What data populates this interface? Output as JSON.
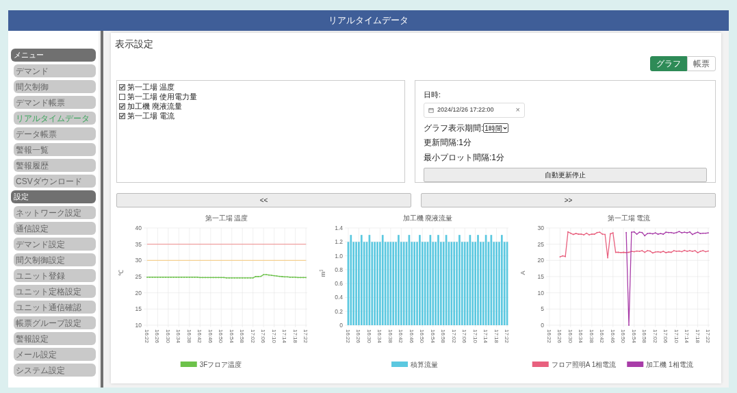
{
  "header": {
    "title": "リアルタイムデータ"
  },
  "sidebar": {
    "sections": [
      {
        "title": "メニュー",
        "items": [
          {
            "label": "デマンド",
            "selected": false
          },
          {
            "label": "間欠制御",
            "selected": false
          },
          {
            "label": "デマンド帳票",
            "selected": false
          },
          {
            "label": "リアルタイムデータ",
            "selected": true
          },
          {
            "label": "データ帳票",
            "selected": false
          },
          {
            "label": "警報一覧",
            "selected": false
          },
          {
            "label": "警報履歴",
            "selected": false
          },
          {
            "label": "CSVダウンロード",
            "selected": false
          }
        ]
      },
      {
        "title": "設定",
        "items": [
          {
            "label": "ネットワーク設定",
            "selected": false
          },
          {
            "label": "通信設定",
            "selected": false
          },
          {
            "label": "デマンド設定",
            "selected": false
          },
          {
            "label": "間欠制御設定",
            "selected": false
          },
          {
            "label": "ユニット登録",
            "selected": false
          },
          {
            "label": "ユニット定格設定",
            "selected": false
          },
          {
            "label": "ユニット通信確認",
            "selected": false
          },
          {
            "label": "帳票グループ設定",
            "selected": false
          },
          {
            "label": "警報設定",
            "selected": false
          },
          {
            "label": "メール設定",
            "selected": false
          },
          {
            "label": "システム設定",
            "selected": false
          }
        ]
      }
    ]
  },
  "main": {
    "title": "表示設定",
    "view_toggle": [
      {
        "label": "グラフ",
        "selected": true
      },
      {
        "label": "帳票",
        "selected": false
      }
    ],
    "series_list": [
      {
        "label": "第一工場 温度",
        "checked": true
      },
      {
        "label": "第一工場 使用電力量",
        "checked": false
      },
      {
        "label": "加工機 廃液流量",
        "checked": true
      },
      {
        "label": "第一工場 電流",
        "checked": true
      }
    ],
    "settings": {
      "datetime_label": "日時:",
      "datetime_value": "2024/12/26 17:22:00",
      "clear": "×",
      "period_label": "グラフ表示期間:",
      "period_value": "1時間",
      "update_interval": "更新間隔:1分",
      "min_plot_interval": "最小プロット間隔:1分",
      "stop_button": "自動更新停止"
    },
    "nav": {
      "prev": "<<",
      "next": ">>"
    },
    "charts": [
      {
        "chart_data": {
          "type": "line",
          "title": "第一工場 温度",
          "ylabel": "℃",
          "ylim": [
            10,
            40
          ],
          "yticks": [
            10,
            15,
            20,
            25,
            30,
            35,
            40
          ],
          "grid": true,
          "legend": "bottom",
          "categories": [
            "16:22",
            null,
            null,
            null,
            "16:26",
            null,
            null,
            null,
            "16:30",
            null,
            null,
            null,
            "16:34",
            null,
            null,
            null,
            "16:38",
            null,
            null,
            null,
            "16:42",
            null,
            null,
            null,
            "16:46",
            null,
            null,
            null,
            "16:50",
            null,
            null,
            null,
            "16:54",
            null,
            null,
            null,
            "16:58",
            null,
            null,
            null,
            "17:02",
            null,
            null,
            null,
            "17:06",
            null,
            null,
            null,
            "17:10",
            null,
            null,
            null,
            "17:14",
            null,
            null,
            null,
            "17:18",
            null,
            null,
            null,
            "17:22"
          ],
          "series": [
            {
              "color": "#f0a0a0",
              "values": [
                35,
                35,
                35,
                35,
                35,
                35,
                35,
                35,
                35,
                35,
                35,
                35,
                35,
                35,
                35,
                35,
                35,
                35,
                35,
                35,
                35,
                35,
                35,
                35,
                35,
                35,
                35,
                35,
                35,
                35,
                35,
                35,
                35,
                35,
                35,
                35,
                35,
                35,
                35,
                35,
                35,
                35,
                35,
                35,
                35,
                35,
                35,
                35,
                35,
                35,
                35,
                35,
                35,
                35,
                35,
                35,
                35,
                35,
                35,
                35,
                35
              ]
            },
            {
              "color": "#f5d090",
              "values": [
                30,
                30,
                30,
                30,
                30,
                30,
                30,
                30,
                30,
                30,
                30,
                30,
                30,
                30,
                30,
                30,
                30,
                30,
                30,
                30,
                30,
                30,
                30,
                30,
                30,
                30,
                30,
                30,
                30,
                30,
                30,
                30,
                30,
                30,
                30,
                30,
                30,
                30,
                30,
                30,
                30,
                30,
                30,
                30,
                30,
                30,
                30,
                30,
                30,
                30,
                30,
                30,
                30,
                30,
                30,
                30,
                30,
                30,
                30,
                30,
                30
              ]
            },
            {
              "name": "3Fフロア温度",
              "color": "#6cc24a",
              "values": [
                24.8,
                24.8,
                24.8,
                24.8,
                24.8,
                24.8,
                24.8,
                24.8,
                24.8,
                24.8,
                24.8,
                24.8,
                24.8,
                24.8,
                24.8,
                24.8,
                24.8,
                24.8,
                24.8,
                24.8,
                24.7,
                24.7,
                24.7,
                24.7,
                24.7,
                24.7,
                24.7,
                24.7,
                24.7,
                24.7,
                24.6,
                24.6,
                24.6,
                24.6,
                24.6,
                24.6,
                24.6,
                24.6,
                24.6,
                24.6,
                24.6,
                25.0,
                25.0,
                25.1,
                25.6,
                25.6,
                25.5,
                25.4,
                25.3,
                25.2,
                25.1,
                25.0,
                24.9,
                24.9,
                24.8,
                24.8,
                24.8,
                24.7,
                24.7,
                24.7,
                24.7
              ]
            }
          ]
        }
      },
      {
        "chart_data": {
          "type": "bar",
          "title": "加工機 廃液流量",
          "ylabel": "m$^{3}$",
          "ylim": [
            0,
            1.4
          ],
          "yticks": [
            {
              "value": 0,
              "label": "0"
            },
            {
              "value": 0.2,
              "label": "0.2"
            },
            {
              "value": 0.4,
              "label": "0.4"
            },
            {
              "value": 0.6,
              "label": "0.6"
            },
            {
              "value": 0.8,
              "label": "0.8"
            },
            {
              "value": 1,
              "label": "1.0"
            },
            {
              "value": 1.2,
              "label": "1.2"
            },
            {
              "value": 1.4,
              "label": "1.4"
            }
          ],
          "grid": true,
          "legend": "bottom",
          "categories": [
            "16:22",
            null,
            null,
            null,
            "16:26",
            null,
            null,
            null,
            "16:30",
            null,
            null,
            null,
            "16:34",
            null,
            null,
            null,
            "16:38",
            null,
            null,
            null,
            "16:42",
            null,
            null,
            null,
            "16:46",
            null,
            null,
            null,
            "16:50",
            null,
            null,
            null,
            "16:54",
            null,
            null,
            null,
            "16:58",
            null,
            null,
            null,
            "17:02",
            null,
            null,
            null,
            "17:06",
            null,
            null,
            null,
            "17:10",
            null,
            null,
            null,
            "17:14",
            null,
            null,
            null,
            "17:18",
            null,
            null,
            null,
            "17:22"
          ],
          "series": [
            {
              "name": "積算流量",
              "color": "#5bc8e0",
              "values": [
                1.2,
                1.3,
                1.2,
                1.2,
                1.2,
                1.3,
                1.2,
                1.2,
                1.3,
                1.2,
                1.2,
                1.2,
                1.2,
                1.3,
                1.2,
                1.2,
                1.2,
                1.2,
                1.2,
                1.3,
                1.2,
                1.2,
                1.2,
                1.3,
                1.2,
                1.2,
                1.2,
                1.3,
                1.2,
                1.2,
                1.2,
                1.3,
                1.2,
                1.2,
                1.3,
                1.2,
                1.2,
                1.3,
                1.2,
                1.2,
                1.2,
                1.2,
                1.3,
                1.2,
                1.2,
                1.2,
                1.3,
                1.2,
                1.2,
                1.3,
                1.2,
                1.2,
                1.3,
                1.2,
                1.3,
                1.2,
                1.2,
                1.2,
                1.3,
                1.2,
                1.2
              ]
            }
          ]
        }
      },
      {
        "chart_data": {
          "type": "line",
          "title": "第一工場 電流",
          "ylabel": "A",
          "ylim": [
            0,
            30
          ],
          "yticks": [
            0,
            5,
            10,
            15,
            20,
            25,
            30
          ],
          "grid": true,
          "legend": "bottom",
          "categories": [
            "16:22",
            null,
            null,
            null,
            "16:26",
            null,
            null,
            null,
            "16:30",
            null,
            null,
            null,
            "16:34",
            null,
            null,
            null,
            "16:38",
            null,
            null,
            null,
            "16:42",
            null,
            null,
            null,
            "16:46",
            null,
            null,
            null,
            "16:50",
            null,
            null,
            null,
            "16:54",
            null,
            null,
            null,
            "16:58",
            null,
            null,
            null,
            "17:02",
            null,
            null,
            null,
            "17:06",
            null,
            null,
            null,
            "17:10",
            null,
            null,
            null,
            "17:14",
            null,
            null,
            null,
            "17:18",
            null,
            null,
            null,
            "17:22"
          ],
          "series": [
            {
              "name": "フロア照明A 1相電流",
              "color": "#e8607e",
              "values": [
                null,
                null,
                null,
                null,
                21.1,
                21.4,
                21.2,
                28.8,
                28.4,
                28.0,
                28.3,
                28.1,
                28.1,
                27.9,
                28.4,
                27.9,
                28.1,
                28.1,
                28.6,
                28.7,
                28.1,
                28.0,
                20.8,
                28.2,
                28.5,
                22.5,
                22.5,
                22.4,
                22.5,
                22.4,
                22.5,
                22.8,
                22.7,
                22.9,
                22.8,
                23.0,
                22.5,
                23.0,
                22.9,
                22.3,
                22.6,
                22.7,
                22.5,
                22.8,
                22.4,
                22.6,
                22.5,
                23.0,
                22.8,
                22.9,
                22.7,
                23.1,
                22.8,
                23.0,
                22.8,
                23.0,
                22.4,
                22.8,
                23.0,
                22.7,
                22.9
              ]
            },
            {
              "name": "加工機 1相電流",
              "color": "#a83ca8",
              "values": [
                null,
                null,
                null,
                null,
                null,
                null,
                null,
                null,
                null,
                null,
                null,
                null,
                null,
                null,
                null,
                null,
                null,
                null,
                null,
                null,
                null,
                null,
                null,
                null,
                null,
                null,
                null,
                null,
                null,
                28.6,
                0,
                28.7,
                28.8,
                28.1,
                28.7,
                28.6,
                27.6,
                28.3,
                28.4,
                28.2,
                28.5,
                28.1,
                28.3,
                28.1,
                28.7,
                28.6,
                28.6,
                28.4,
                28.6,
                28.9,
                28.5,
                28.7,
                28.5,
                28.8,
                28.0,
                28.4,
                28.7,
                28.3,
                28.4,
                28.4,
                28.5
              ]
            }
          ]
        }
      }
    ]
  }
}
